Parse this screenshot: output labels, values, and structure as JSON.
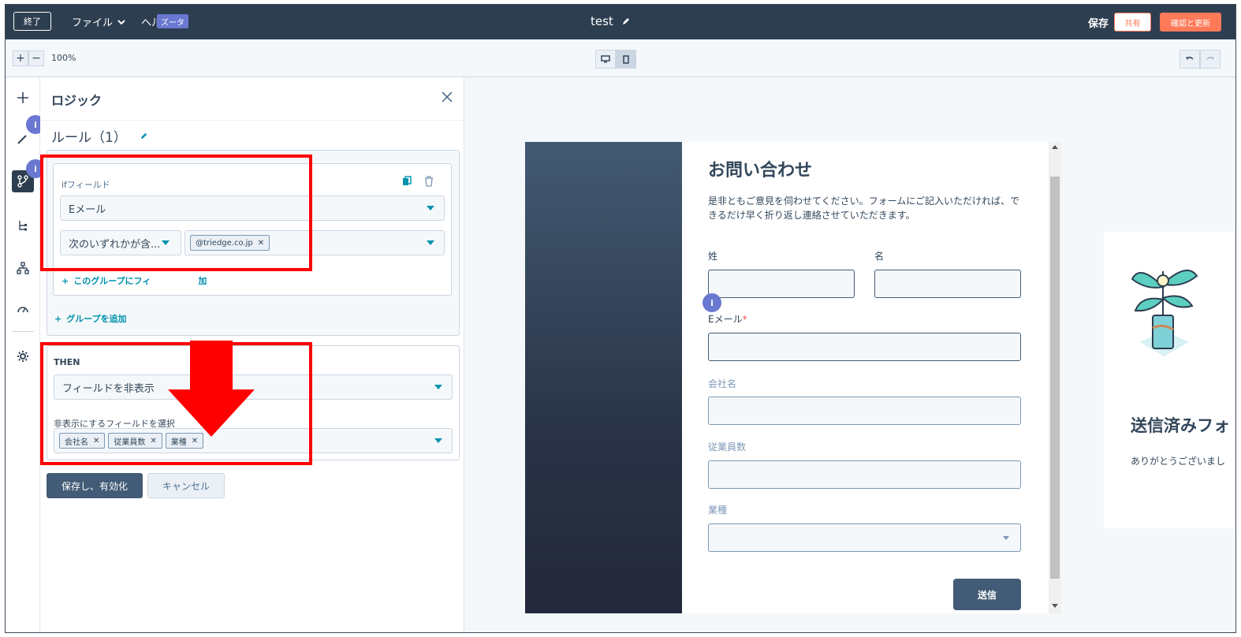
{
  "topbar": {
    "exit_label": "終了",
    "file_menu": "ファイル",
    "help_menu": "ヘル",
    "help_badge": "ズータ",
    "doc_title": "test",
    "save_label": "保存",
    "share_label": "共有",
    "review_label": "確認と更新"
  },
  "toolbar": {
    "zoom_in": "+",
    "zoom_out": "−",
    "zoom_level": "100%"
  },
  "rail": {
    "add_icon": "plus-icon",
    "info_label": "i"
  },
  "panel": {
    "title": "ロジック",
    "rule_title": "ルール（1）",
    "if_label": "ifフィールド",
    "if_field_value": "Eメール",
    "operator_value": "次のいずれかが含...",
    "tag_value": "@triedge.co.jp",
    "add_filter_link": "このグループにフィ",
    "add_filter_link_tail": "加",
    "add_group_link": "グループを追加",
    "then_title": "THEN",
    "then_action_value": "フィールドを非表示",
    "hide_label": "非表示にするフィールドを選択",
    "hide_tags": [
      "会社名",
      "従業員数",
      "業種"
    ],
    "save_activate_label": "保存し、有効化",
    "cancel_label": "キャンセル"
  },
  "form": {
    "title": "お問い合わせ",
    "description": "是非ともご意見を伺わせてください。フォームにご記入いただければ、できるだけ早く折り返し連絡させていただきます。",
    "last_name_label": "姓",
    "first_name_label": "名",
    "email_label": "Eメール",
    "required_mark": "*",
    "company_label": "会社名",
    "employees_label": "従業員数",
    "industry_label": "業種",
    "submit_label": "送信"
  },
  "thanks": {
    "title": "送信済みフォ",
    "text": "ありがとうございまし"
  },
  "colors": {
    "topbar": "#2d3e50",
    "accent": "#ff7a59",
    "link": "#0091ae",
    "annotation": "#ff0000",
    "info": "#6a78d1"
  }
}
